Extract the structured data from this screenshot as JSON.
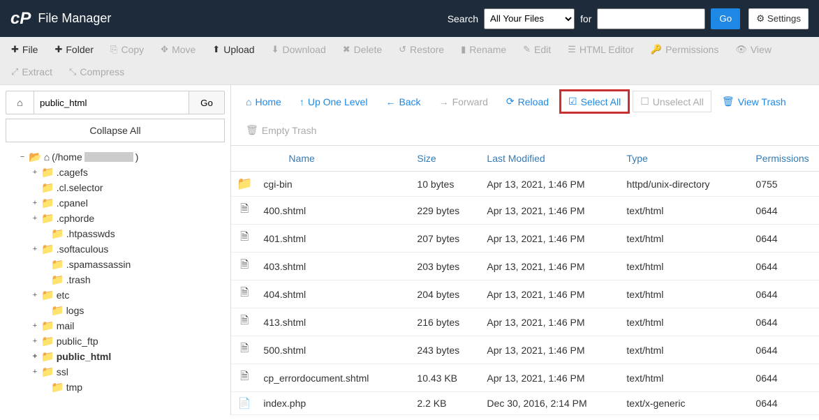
{
  "header": {
    "title": "File Manager",
    "search_label": "Search",
    "search_scope": "All Your Files",
    "for_label": "for",
    "search_value": "",
    "go_label": "Go",
    "settings_label": "Settings"
  },
  "toolbar": {
    "file": "File",
    "folder": "Folder",
    "copy": "Copy",
    "move": "Move",
    "upload": "Upload",
    "download": "Download",
    "delete": "Delete",
    "restore": "Restore",
    "rename": "Rename",
    "edit": "Edit",
    "html_editor": "HTML Editor",
    "permissions": "Permissions",
    "view": "View",
    "extract": "Extract",
    "compress": "Compress"
  },
  "sidebar": {
    "path_value": "public_html",
    "go_label": "Go",
    "collapse_all": "Collapse All",
    "tree": {
      "root": "(/home",
      "items": [
        {
          "label": ".cagefs",
          "expandable": true
        },
        {
          "label": ".cl.selector",
          "expandable": false
        },
        {
          "label": ".cpanel",
          "expandable": true
        },
        {
          "label": ".cphorde",
          "expandable": true
        },
        {
          "label": ".htpasswds",
          "expandable": false,
          "indent": true
        },
        {
          "label": ".softaculous",
          "expandable": true
        },
        {
          "label": ".spamassassin",
          "expandable": false,
          "indent": true
        },
        {
          "label": ".trash",
          "expandable": false,
          "indent": true
        },
        {
          "label": "etc",
          "expandable": true
        },
        {
          "label": "logs",
          "expandable": false,
          "indent": true
        },
        {
          "label": "mail",
          "expandable": true
        },
        {
          "label": "public_ftp",
          "expandable": true
        },
        {
          "label": "public_html",
          "expandable": true,
          "bold": true
        },
        {
          "label": "ssl",
          "expandable": true
        },
        {
          "label": "tmp",
          "expandable": false,
          "indent": true
        }
      ]
    }
  },
  "main_toolbar": {
    "home": "Home",
    "up_one_level": "Up One Level",
    "back": "Back",
    "forward": "Forward",
    "reload": "Reload",
    "select_all": "Select All",
    "unselect_all": "Unselect All",
    "view_trash": "View Trash",
    "empty_trash": "Empty Trash"
  },
  "table": {
    "headers": {
      "name": "Name",
      "size": "Size",
      "last_modified": "Last Modified",
      "type": "Type",
      "permissions": "Permissions"
    },
    "rows": [
      {
        "icon": "folder",
        "name": "cgi-bin",
        "size": "10 bytes",
        "modified": "Apr 13, 2021, 1:46 PM",
        "type": "httpd/unix-directory",
        "perm": "0755"
      },
      {
        "icon": "html",
        "name": "400.shtml",
        "size": "229 bytes",
        "modified": "Apr 13, 2021, 1:46 PM",
        "type": "text/html",
        "perm": "0644"
      },
      {
        "icon": "html",
        "name": "401.shtml",
        "size": "207 bytes",
        "modified": "Apr 13, 2021, 1:46 PM",
        "type": "text/html",
        "perm": "0644"
      },
      {
        "icon": "html",
        "name": "403.shtml",
        "size": "203 bytes",
        "modified": "Apr 13, 2021, 1:46 PM",
        "type": "text/html",
        "perm": "0644"
      },
      {
        "icon": "html",
        "name": "404.shtml",
        "size": "204 bytes",
        "modified": "Apr 13, 2021, 1:46 PM",
        "type": "text/html",
        "perm": "0644"
      },
      {
        "icon": "html",
        "name": "413.shtml",
        "size": "216 bytes",
        "modified": "Apr 13, 2021, 1:46 PM",
        "type": "text/html",
        "perm": "0644"
      },
      {
        "icon": "html",
        "name": "500.shtml",
        "size": "243 bytes",
        "modified": "Apr 13, 2021, 1:46 PM",
        "type": "text/html",
        "perm": "0644"
      },
      {
        "icon": "html",
        "name": "cp_errordocument.shtml",
        "size": "10.43 KB",
        "modified": "Apr 13, 2021, 1:46 PM",
        "type": "text/html",
        "perm": "0644"
      },
      {
        "icon": "generic",
        "name": "index.php",
        "size": "2.2 KB",
        "modified": "Dec 30, 2016, 2:14 PM",
        "type": "text/x-generic",
        "perm": "0644"
      }
    ]
  }
}
